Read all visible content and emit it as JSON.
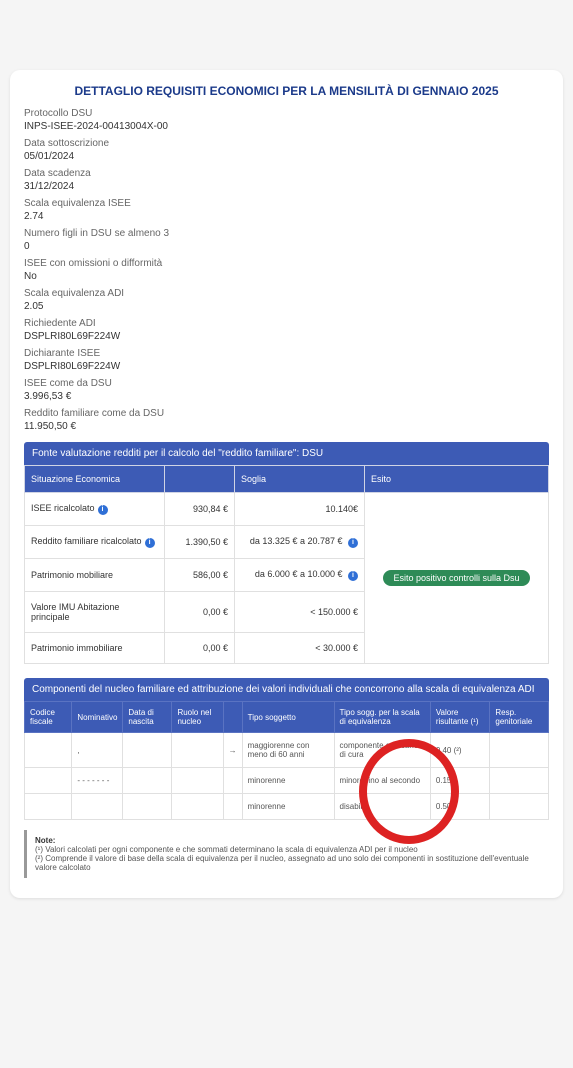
{
  "title": "DETTAGLIO REQUISITI ECONOMICI PER LA MENSILITÀ DI GENNAIO 2025",
  "fields": [
    {
      "label": "Protocollo DSU",
      "value": "INPS-ISEE-2024-00413004X-00"
    },
    {
      "label": "Data sottoscrizione",
      "value": "05/01/2024"
    },
    {
      "label": "Data scadenza",
      "value": "31/12/2024"
    },
    {
      "label": "Scala equivalenza ISEE",
      "value": "2.74"
    },
    {
      "label": "Numero figli in DSU se almeno 3",
      "value": "0"
    },
    {
      "label": "ISEE con omissioni o difformità",
      "value": "No"
    },
    {
      "label": "Scala equivalenza ADI",
      "value": "2.05"
    },
    {
      "label": "Richiedente ADI",
      "value": "DSPLRI80L69F224W"
    },
    {
      "label": "Dichiarante ISEE",
      "value": "DSPLRI80L69F224W"
    },
    {
      "label": "ISEE come da DSU",
      "value": "3.996,53 €"
    },
    {
      "label": "Reddito familiare come da DSU",
      "value": "11.950,50 €"
    }
  ],
  "tbl1": {
    "header": "Fonte valutazione redditi per il calcolo del \"reddito familiare\": DSU",
    "cols": {
      "c1": "Situazione Economica",
      "c2": "",
      "c3": "Soglia",
      "c4": "Esito"
    },
    "rows": [
      {
        "name": "ISEE ricalcolato",
        "info1": true,
        "value": "930,84 €",
        "soglia": "10.140€",
        "info2": false
      },
      {
        "name": "Reddito familiare ricalcolato",
        "info1": true,
        "value": "1.390,50 €",
        "soglia": "da 13.325 € a 20.787 €",
        "info2": true
      },
      {
        "name": "Patrimonio mobiliare",
        "info1": false,
        "value": "586,00 €",
        "soglia": "da 6.000 € a 10.000 €",
        "info2": true
      },
      {
        "name": "Valore IMU Abitazione principale",
        "info1": false,
        "value": "0,00 €",
        "soglia": "< 150.000 €",
        "info2": false
      },
      {
        "name": "Patrimonio immobiliare",
        "info1": false,
        "value": "0,00 €",
        "soglia": "< 30.000 €",
        "info2": false
      }
    ],
    "esito": "Esito positivo controlli sulla Dsu"
  },
  "tbl2": {
    "header": "Componenti del nucleo familiare ed attribuzione dei valori individuali che concorrono alla scala di equivalenza ADI",
    "cols": [
      "Codice fiscale",
      "Nominativo",
      "Data di nascita",
      "Ruolo nel nucleo",
      "",
      "Tipo soggetto",
      "Tipo sogg. per la scala di equivalenza",
      "Valore risultante (¹)",
      "Resp. genitoriale"
    ],
    "rows": [
      {
        "cf": "",
        "nom": ",",
        "dn": "",
        "ruolo": "",
        "arrow": "→",
        "tipo": "maggiorenne con meno di 60 anni",
        "tipoScala": "componente con carico di cura",
        "valore": "0.40 (²)",
        "resp": ""
      },
      {
        "cf": "",
        "nom": "- - - - - - -",
        "dn": "",
        "ruolo": "",
        "arrow": "",
        "tipo": "minorenne",
        "tipoScala": "minore fino al secondo",
        "valore": "0.15",
        "resp": ""
      },
      {
        "cf": "",
        "nom": "",
        "dn": "",
        "ruolo": "",
        "arrow": "",
        "tipo": "minorenne",
        "tipoScala": "disabile",
        "valore": "0.50",
        "resp": ""
      }
    ]
  },
  "note": {
    "title": "Note:",
    "n1": "(¹) Valori calcolati per ogni componente e che sommati determinano la scala di equivalenza ADI per il nucleo",
    "n2": "(²) Comprende il valore di base della scala di equivalenza per il nucleo, assegnato ad uno solo dei componenti in sostituzione dell'eventuale valore calcolato"
  }
}
